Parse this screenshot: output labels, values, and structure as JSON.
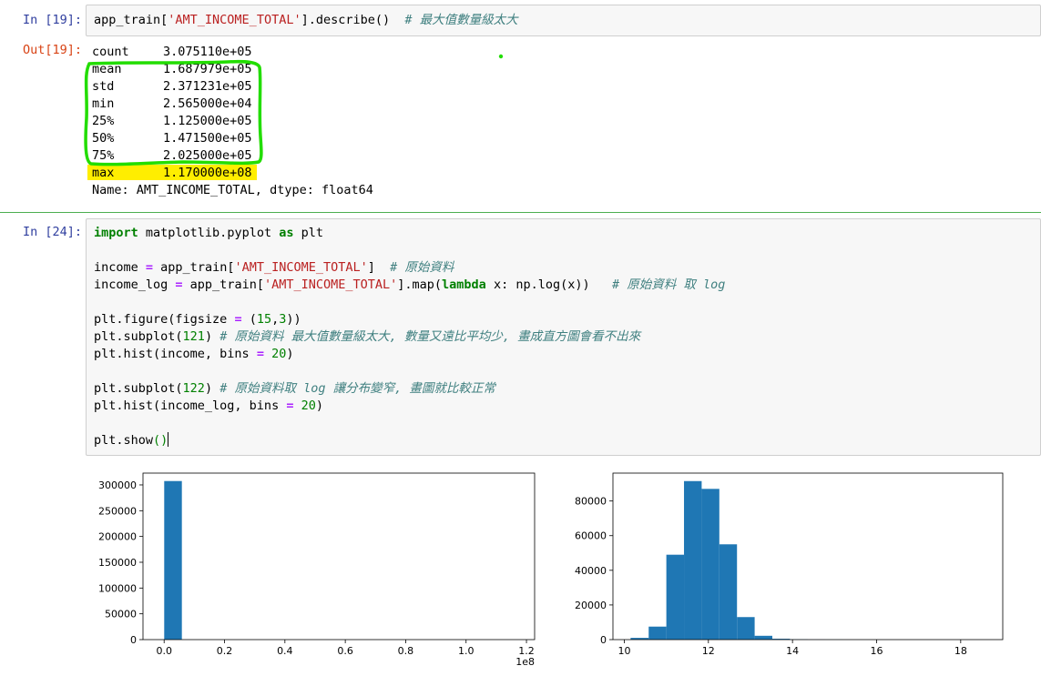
{
  "cell19": {
    "in_prompt": "In [19]:",
    "out_prompt": "Out[19]:",
    "code_parts": [
      "app_train[",
      "'AMT_INCOME_TOTAL'",
      "].describe()  ",
      "# 最大值數量級太大"
    ],
    "describe_rows": [
      {
        "label": "count",
        "value": "3.075110e+05"
      },
      {
        "label": "mean",
        "value": "1.687979e+05"
      },
      {
        "label": "std",
        "value": "2.371231e+05"
      },
      {
        "label": "min",
        "value": "2.565000e+04"
      },
      {
        "label": "25%",
        "value": "1.125000e+05"
      },
      {
        "label": "50%",
        "value": "1.471500e+05"
      },
      {
        "label": "75%",
        "value": "2.025000e+05"
      },
      {
        "label": "max",
        "value": "1.170000e+08"
      }
    ],
    "dtype_line": "Name: AMT_INCOME_TOTAL, dtype: float64",
    "annotation_colors": {
      "box": "#22dd00",
      "highlight": "#ffee00"
    }
  },
  "cell24": {
    "in_prompt": "In [24]:",
    "lines": {
      "l1": {
        "import": "import",
        "mod": " matplotlib.pyplot ",
        "as": "as",
        "alias": " plt"
      },
      "l2": {
        "a": "income ",
        "eq": "=",
        "b": " app_train[",
        "s": "'AMT_INCOME_TOTAL'",
        "c": "]  ",
        "cm": "# 原始資料"
      },
      "l3": {
        "a": "income_log ",
        "eq": "=",
        "b": " app_train[",
        "s": "'AMT_INCOME_TOTAL'",
        "c": "].map(",
        "kw": "lambda",
        "d": " x: np.log(x))   ",
        "cm": "# 原始資料 取 log"
      },
      "l4": {
        "a": "plt.figure(figsize ",
        "eq": "=",
        "b": " (",
        "n1": "15",
        "c": ",",
        "n2": "3",
        "d": "))"
      },
      "l5": {
        "a": "plt.subplot(",
        "n": "121",
        "b": ") ",
        "cm": "# 原始資料 最大值數量級太大, 數量又遠比平均少, 畫成直方圖會看不出來"
      },
      "l6": {
        "a": "plt.hist(income, bins ",
        "eq": "=",
        "b": " ",
        "n": "20",
        "c": ")"
      },
      "l7": {
        "a": "plt.subplot(",
        "n": "122",
        "b": ") ",
        "cm": "# 原始資料取 log 讓分布變窄, 畫圖就比較正常"
      },
      "l8": {
        "a": "plt.hist(income_log, bins ",
        "eq": "=",
        "b": " ",
        "n": "20",
        "c": ")"
      },
      "l9": {
        "a": "plt.show",
        "p": "()"
      }
    }
  },
  "chart_data": [
    {
      "type": "bar",
      "x_edges": [
        25650,
        5874870,
        11724090,
        17573310,
        23422530,
        29271750,
        35120970,
        40970190,
        46819410,
        52668630,
        58517850,
        64367070,
        70216290,
        76065510,
        81914730,
        87763950,
        93613170,
        99462390,
        105311610,
        111160830,
        117010050
      ],
      "values": [
        307510,
        0,
        0,
        0,
        0,
        0,
        0,
        0,
        0,
        0,
        0,
        0,
        0,
        0,
        0,
        0,
        0,
        0,
        0,
        1
      ],
      "xlim": [
        -7000000,
        122700000
      ],
      "ylim": [
        0,
        322886
      ],
      "xticks": [
        "0.0",
        "0.2",
        "0.4",
        "0.6",
        "0.8",
        "1.0",
        "1.2"
      ],
      "xtick_values": [
        0,
        0.2,
        0.4,
        0.6,
        0.8,
        1.0,
        1.2
      ],
      "yticks": [
        "0",
        "50000",
        "100000",
        "150000",
        "200000",
        "250000",
        "300000"
      ],
      "ytick_values": [
        0,
        50000,
        100000,
        150000,
        200000,
        250000,
        300000
      ],
      "x_offset_label": "1e8",
      "color": "#1f77b4"
    },
    {
      "type": "bar",
      "x_edges": [
        10.15,
        10.58,
        11.0,
        11.42,
        11.84,
        12.26,
        12.68,
        13.1,
        13.52,
        13.94,
        14.36,
        14.78,
        15.2,
        15.63,
        16.05,
        16.47,
        16.89,
        17.31,
        17.73,
        18.15,
        18.58
      ],
      "values": [
        1000,
        7500,
        49000,
        91500,
        87000,
        55000,
        13000,
        2200,
        500,
        150,
        60,
        30,
        10,
        5,
        2,
        1,
        1,
        0,
        0,
        1
      ],
      "xlim": [
        9.73,
        19.0
      ],
      "ylim": [
        0,
        96100
      ],
      "xticks": [
        "10",
        "12",
        "14",
        "16",
        "18"
      ],
      "xtick_values": [
        10,
        12,
        14,
        16,
        18
      ],
      "yticks": [
        "0",
        "20000",
        "40000",
        "60000",
        "80000"
      ],
      "ytick_values": [
        0,
        20000,
        40000,
        60000,
        80000
      ],
      "color": "#1f77b4"
    }
  ]
}
